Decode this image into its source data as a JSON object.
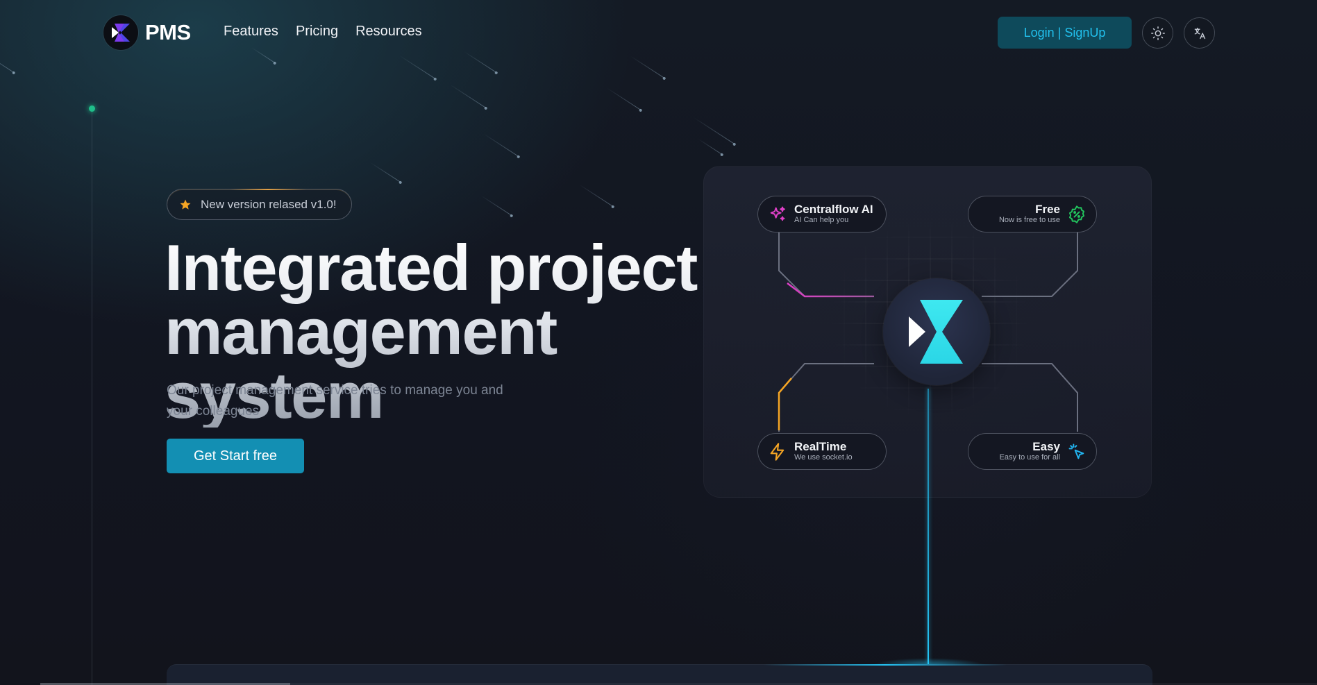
{
  "header": {
    "brand": "PMS",
    "nav": [
      "Features",
      "Pricing",
      "Resources"
    ],
    "login_label": "Login | SignUp",
    "theme_icon": "sun-icon",
    "language_icon": "translate-icon"
  },
  "hero": {
    "badge_icon": "star-icon",
    "badge_text": "New version relased v1.0!",
    "title_line1": "Integrated project",
    "title_line2": "management system",
    "subtitle": "Our project management service tries to manage you and your colleagues",
    "cta_label": "Get Start free"
  },
  "features": [
    {
      "title": "Centralflow AI",
      "subtitle": "AI Can help you",
      "icon": "sparkles-icon",
      "color": "#e040c8"
    },
    {
      "title": "Free",
      "subtitle": "Now is free to use",
      "icon": "discount-badge-icon",
      "color": "#22c55e"
    },
    {
      "title": "RealTime",
      "subtitle": "We use socket.io",
      "icon": "lightning-icon",
      "color": "#f5a524"
    },
    {
      "title": "Easy",
      "subtitle": "Easy to use for all",
      "icon": "cursor-click-icon",
      "color": "#22b5f0"
    }
  ],
  "colors": {
    "accent": "#138fb3",
    "login_bg": "#0e4a5b",
    "login_text": "#22c1ee",
    "beam": "#25c4f5",
    "status_dot": "#1fbf8a"
  }
}
